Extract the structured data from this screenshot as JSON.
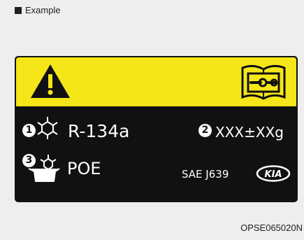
{
  "heading": {
    "text": "Example"
  },
  "label": {
    "refrigerant_number": "1",
    "refrigerant_type": "R-134a",
    "amount_number": "2",
    "refrigerant_amount": "XXX±XXg",
    "oil_number": "3",
    "oil_type": "POE",
    "standard": "SAE J639",
    "brand_logo_text": "KIA"
  },
  "colors": {
    "label_background": "#111111",
    "warning_band": "#f4e619",
    "page_background": "#eeeeef"
  },
  "icons": [
    "warning-triangle-icon",
    "service-manual-icon",
    "snowflake-icon",
    "oil-can-snowflake-icon",
    "kia-logo-icon"
  ],
  "figure_code": "OPSE065020N"
}
